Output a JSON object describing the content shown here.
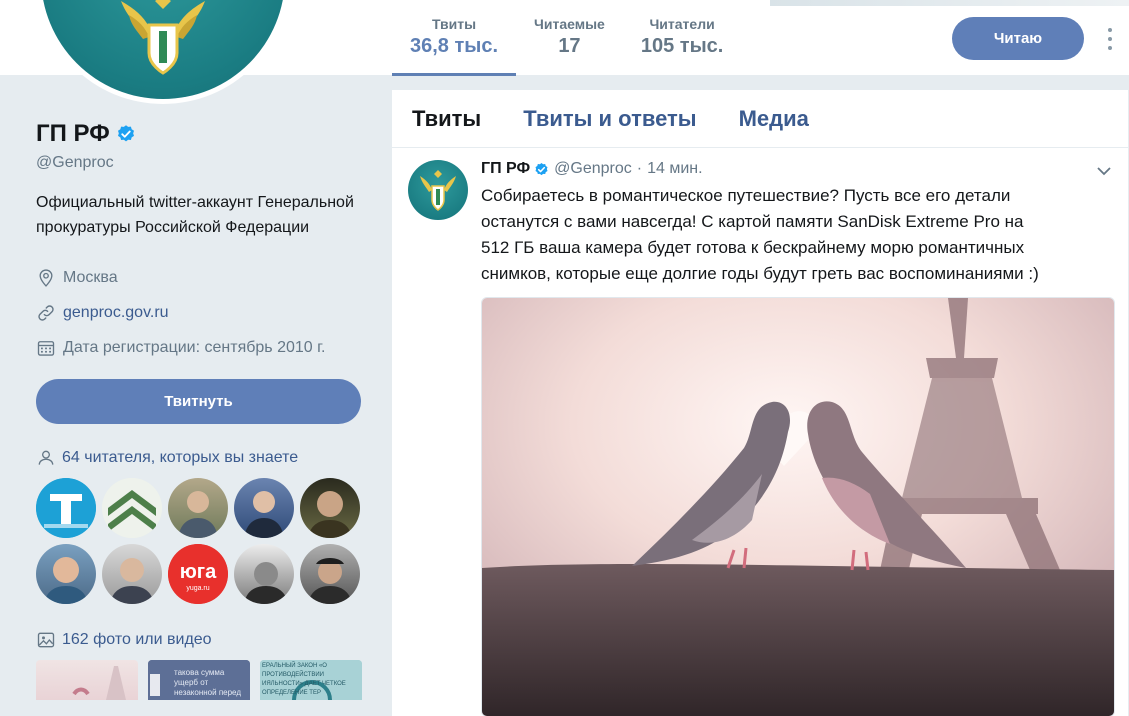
{
  "banner": {
    "tail_text": ""
  },
  "nav": {
    "stats": [
      {
        "label": "Твиты",
        "value": "36,8 тыс.",
        "active": true
      },
      {
        "label": "Читаемые",
        "value": "17",
        "active": false
      },
      {
        "label": "Читатели",
        "value": "105 тыс.",
        "active": false
      }
    ],
    "follow_label": "Читаю"
  },
  "profile": {
    "name": "ГП РФ",
    "handle": "@Genproc",
    "bio": "Официальный twitter-аккаунт Генеральной прокуратуры Российской Федерации",
    "location": "Москва",
    "website": "genproc.gov.ru",
    "joined": "Дата регистрации: сентябрь 2010 г.",
    "tweet_button": "Твитнуть",
    "followers_you_know": "64 читателя, которых вы знаете",
    "media_count": "162 фото или видео",
    "follower_avatars": [
      {
        "kind": "logo-t",
        "color": "#1da1d6"
      },
      {
        "kind": "chevrons",
        "color": "#4d7f4a"
      },
      {
        "kind": "person",
        "color": "#7a8a6a"
      },
      {
        "kind": "person",
        "color": "#3d5a85"
      },
      {
        "kind": "person",
        "color": "#5a5a3e"
      },
      {
        "kind": "person",
        "color": "#4a6e8e"
      },
      {
        "kind": "person",
        "color": "#8a8a8a"
      },
      {
        "kind": "yuga",
        "color": "#e8302c",
        "text": "югa",
        "subtext": "yuga.ru"
      },
      {
        "kind": "person",
        "color": "#6b6b6b"
      },
      {
        "kind": "person",
        "color": "#444"
      }
    ],
    "thumb_texts": [
      "",
      "таковa сумма ущерб от незаконной перед",
      "ЕРАЛЬНЫЙ ЗАКОН «О ПРОТИВОДЕЙСТВИИ ИЯЛЬНОСТИ» ДАЕТ ЧЕТКОЕ ОПРЕДЕЛЕНИЕ ТЕР"
    ]
  },
  "timeline": {
    "tabs": [
      {
        "label": "Твиты",
        "active": true
      },
      {
        "label": "Твиты и ответы",
        "active": false
      },
      {
        "label": "Медиа",
        "active": false
      }
    ],
    "tweet": {
      "name": "ГП РФ",
      "handle": "@Genproc",
      "time": "14 мин.",
      "text": "Собираетесь в романтическое путешествие? Пусть все его детали останутся с вами навсегда! С картой памяти SanDisk Extreme Pro на 512 ГБ ваша камера будет готова к бескрайнему морю романтичных снимков, которые еще долгие годы будут греть вас воспоминаниями :)"
    }
  },
  "colors": {
    "accent": "#5f7fb8",
    "link": "#3b5b8f",
    "verified": "#1da1f2",
    "avatar_teal": "#1a7c82"
  }
}
